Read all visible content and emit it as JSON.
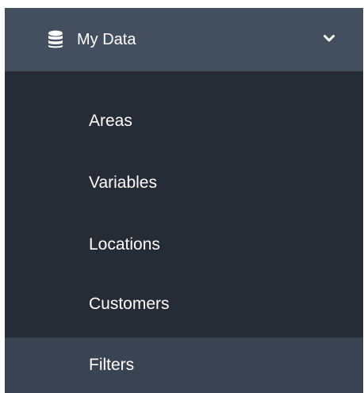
{
  "menu": {
    "header": {
      "label": "My Data",
      "icon": "database-icon",
      "toggle_icon": "chevron-down-icon",
      "expanded": true
    },
    "items": [
      {
        "label": "Areas",
        "active": false
      },
      {
        "label": "Variables",
        "active": false
      },
      {
        "label": "Locations",
        "active": false
      },
      {
        "label": "Customers",
        "active": false
      },
      {
        "label": "Filters",
        "active": true
      }
    ]
  },
  "colors": {
    "header_bg": "#434e5f",
    "menu_bg": "#262c35",
    "active_item_bg": "#3a4352",
    "text": "#ffffff"
  }
}
